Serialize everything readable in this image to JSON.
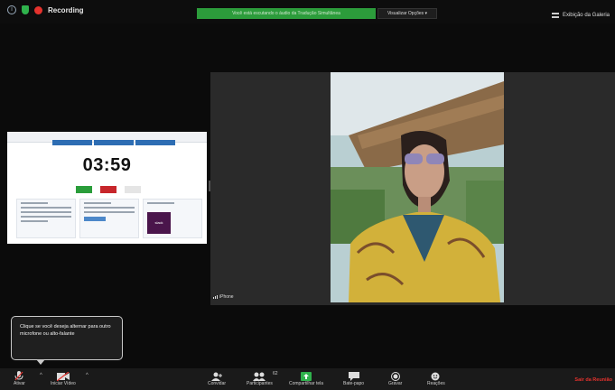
{
  "topbar": {
    "recording_label": "Recording",
    "banner_text": "Você está escutando o áudio da Tradução Simultânea",
    "viewer_label": "Visualizar Opções",
    "gallery_label": "Exibição da Galeria"
  },
  "share": {
    "timer": "03:59"
  },
  "participant": {
    "name": "iPhone"
  },
  "tooltip": {
    "text": "Clique se você deseja alternar para outro microfone ou alto-falante"
  },
  "toolbar": {
    "mute_label": "Ativar",
    "video_label": "Iniciar Vídeo",
    "invite_label": "Convidar",
    "participants_label": "Participantes",
    "participants_count": "62",
    "share_label": "Compartilhar tela",
    "chat_label": "Bate-papo",
    "record_label": "Gravar",
    "reactions_label": "Reações",
    "end_label": "Sair da Reunião"
  },
  "colors": {
    "recording": "#e5322d",
    "banner": "#2c9c3b",
    "share_button": "#2fb24c"
  }
}
